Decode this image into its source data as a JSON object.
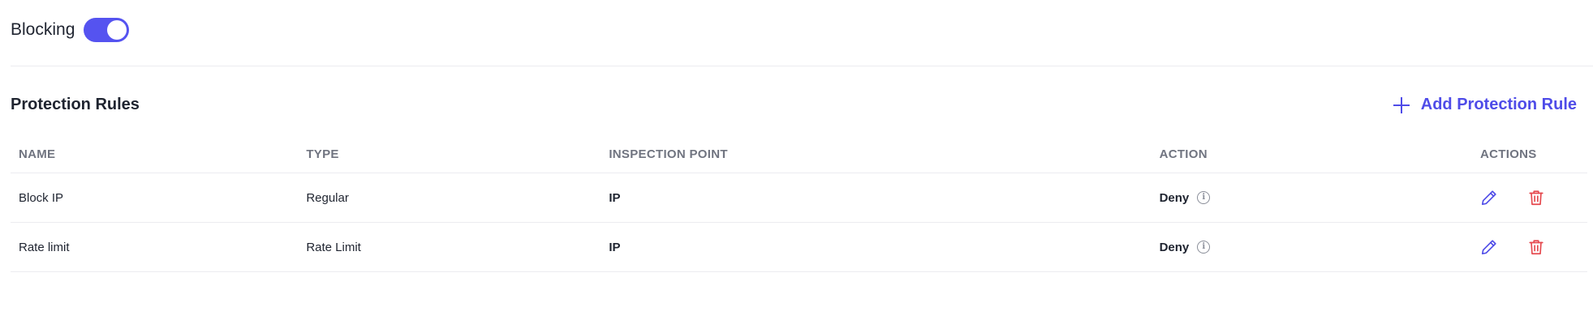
{
  "blocking": {
    "label": "Blocking",
    "enabled": true
  },
  "section": {
    "title": "Protection Rules",
    "add_button_label": "Add Protection Rule",
    "add_icon": "plus-icon"
  },
  "table": {
    "columns": [
      "NAME",
      "TYPE",
      "INSPECTION POINT",
      "ACTION",
      "ACTIONS"
    ],
    "rows": [
      {
        "name": "Block IP",
        "type": "Regular",
        "inspection_point": "IP",
        "action": "Deny"
      },
      {
        "name": "Rate limit",
        "type": "Rate Limit",
        "inspection_point": "IP",
        "action": "Deny"
      }
    ]
  },
  "colors": {
    "accent": "#4f4ce8",
    "toggle_on": "#5553f0",
    "delete": "#e5484d",
    "header_text": "#707480"
  },
  "icons": {
    "edit": "pencil-icon",
    "delete": "trash-icon",
    "info": "info-icon"
  }
}
